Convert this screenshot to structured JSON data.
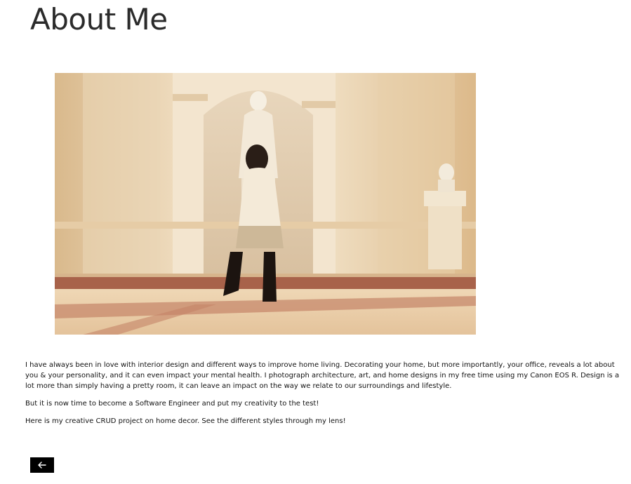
{
  "page": {
    "title": "About Me"
  },
  "photo": {
    "alt": "Woman walking past a statue in a museum hall"
  },
  "content": {
    "paragraphs": [
      "I have always been in love with interior design and different ways to improve home living. Decorating your home, but more importantly, your office, reveals a lot about you & your personality, and it can even impact your mental health. I photograph architecture, art, and home designs in my free time using my Canon EOS R. Design is a lot more than simply having a pretty room, it can leave an impact on the way we relate to our surroundings and lifestyle.",
      "But it is now time to become a Software Engineer and put my creativity to the test!",
      "Here is my creative CRUD project on home decor. See the different styles through my lens!"
    ]
  },
  "back_button": {
    "icon": "arrow-left-icon"
  }
}
